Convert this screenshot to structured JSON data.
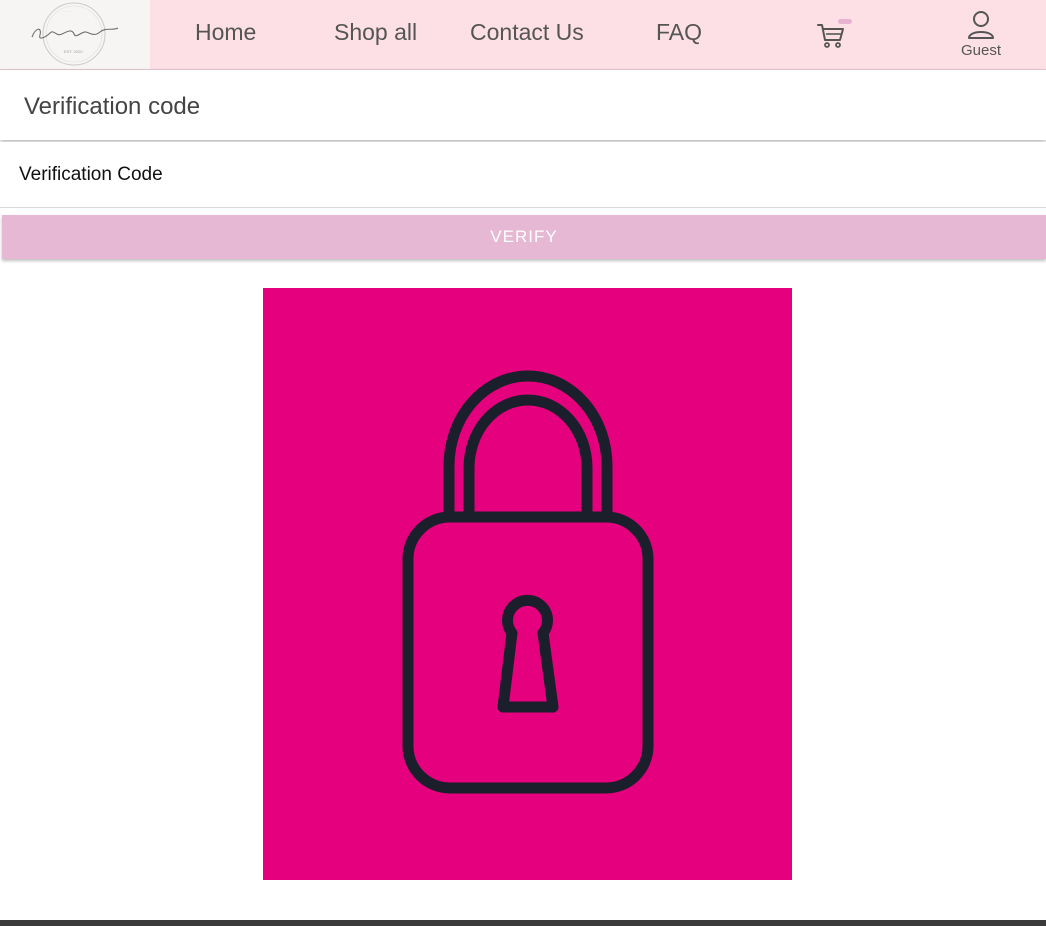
{
  "brand": {
    "logo_text": "It's Personal",
    "logo_arc_text": "the art and the",
    "logo_est": "EST. 2020"
  },
  "nav": {
    "links": [
      {
        "label": "Home"
      },
      {
        "label": "Shop all"
      },
      {
        "label": "Contact Us"
      },
      {
        "label": "FAQ"
      }
    ],
    "cart_icon": "cart-icon",
    "account_icon": "user-icon",
    "account_label": "Guest"
  },
  "page": {
    "title": "Verification code",
    "code_field": {
      "placeholder": "Verification Code",
      "value": ""
    },
    "verify_label": "VERIFY"
  },
  "illustration": {
    "icon": "padlock-icon",
    "background": "#e5007d",
    "stroke": "#1b1f2b"
  },
  "colors": {
    "navbar_bg": "#fde0e6",
    "button_bg": "#e6b8d4",
    "footer": "#3b3b3b"
  }
}
